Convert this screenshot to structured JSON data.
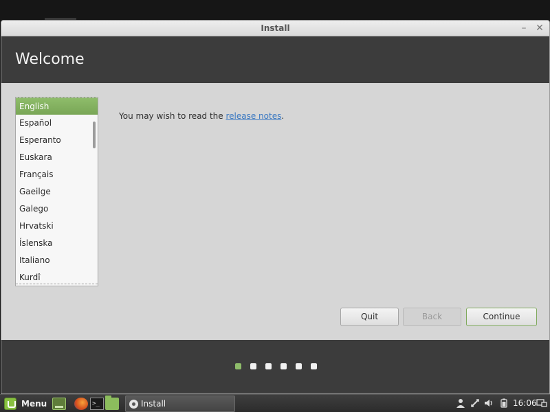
{
  "window": {
    "title": "Install",
    "minimize_glyph": "–",
    "close_glyph": "✕"
  },
  "header": {
    "title": "Welcome"
  },
  "languages": {
    "items": [
      "English",
      "Español",
      "Esperanto",
      "Euskara",
      "Français",
      "Gaeilge",
      "Galego",
      "Hrvatski",
      "Íslenska",
      "Italiano",
      "Kurdî"
    ],
    "selected": "English"
  },
  "release_notes": {
    "prefix": "You may wish to read the ",
    "link_text": "release notes",
    "suffix": "."
  },
  "buttons": {
    "quit": "Quit",
    "back": "Back",
    "continue": "Continue"
  },
  "progress": {
    "steps": 6,
    "current": 1
  },
  "taskbar": {
    "menu_label": "Menu",
    "task_label": "Install",
    "clock": "16:06",
    "terminal_glyph": ">_",
    "icons": [
      "mint-menu-icon",
      "show-desktop-icon",
      "firefox-icon",
      "terminal-icon",
      "files-icon",
      "disc-icon",
      "user-icon",
      "network-icon",
      "volume-icon",
      "battery-icon",
      "workspace-icon"
    ]
  },
  "colors": {
    "accent": "#8ebc6a",
    "header_band": "#3c3c3c",
    "link": "#3b79c2"
  }
}
